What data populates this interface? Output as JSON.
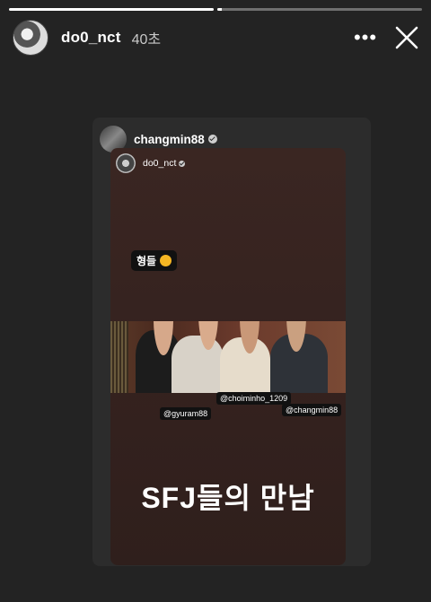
{
  "progress": {
    "segments": [
      1,
      0.2,
      0
    ]
  },
  "header": {
    "username": "do0_nct",
    "time": "40초",
    "more_icon": "more-horizontal-icon",
    "close_icon": "close-icon"
  },
  "shared_post": {
    "username": "changmin88",
    "inner": {
      "username": "do0_nct",
      "sticker": "형들",
      "tags": {
        "choiminho": "@choiminho_1209",
        "gyuram": "@gyuram88",
        "changmin": "@changmin88"
      },
      "caption": "SFJ들의 만남"
    }
  }
}
